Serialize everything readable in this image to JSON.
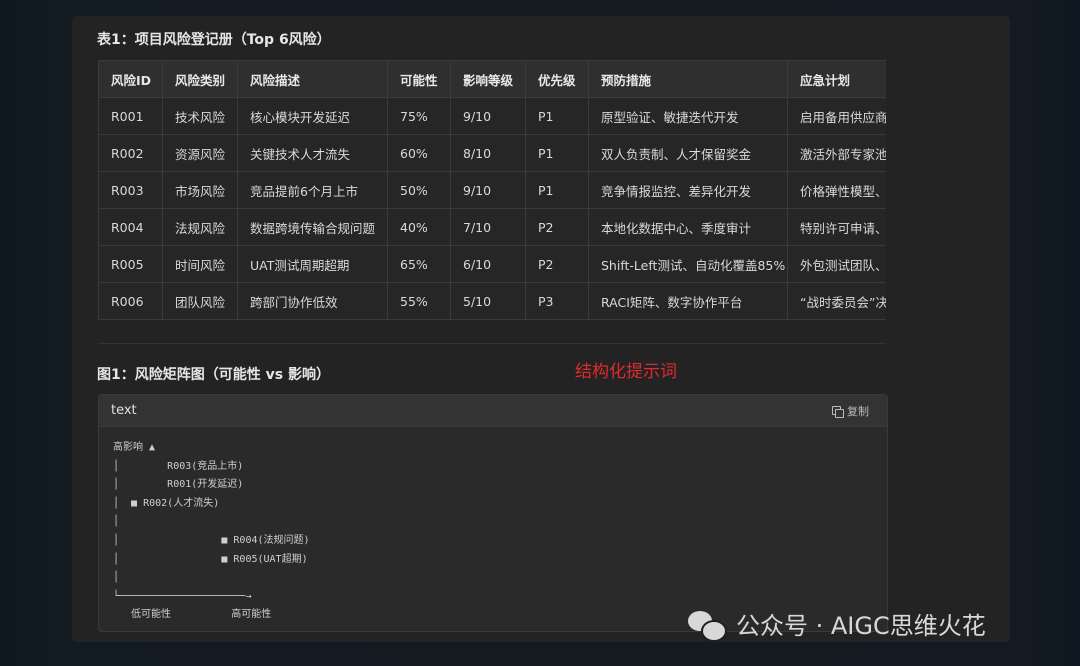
{
  "table_title": "表1：项目风险登记册（Top 6风险）",
  "table": {
    "headers": [
      "风险ID",
      "风险类别",
      "风险描述",
      "可能性",
      "影响等级",
      "优先级",
      "预防措施",
      "应急计划"
    ],
    "rows": [
      [
        "R001",
        "技术风险",
        "核心模块开发延迟",
        "75%",
        "9/10",
        "P1",
        "原型验证、敏捷迭代开发",
        "启用备用供应商"
      ],
      [
        "R002",
        "资源风险",
        "关键技术人才流失",
        "60%",
        "8/10",
        "P1",
        "双人负责制、人才保留奖金",
        "激活外部专家池"
      ],
      [
        "R003",
        "市场风险",
        "竞品提前6个月上市",
        "50%",
        "9/10",
        "P1",
        "竞争情报监控、差异化开发",
        "价格弹性模型、"
      ],
      [
        "R004",
        "法规风险",
        "数据跨境传输合规问题",
        "40%",
        "7/10",
        "P2",
        "本地化数据中心、季度审计",
        "特别许可申请、"
      ],
      [
        "R005",
        "时间风险",
        "UAT测试周期超期",
        "65%",
        "6/10",
        "P2",
        "Shift-Left测试、自动化覆盖85%",
        "外包测试团队、"
      ],
      [
        "R006",
        "团队风险",
        "跨部门协作低效",
        "55%",
        "5/10",
        "P3",
        "RACI矩阵、数字协作平台",
        "“战时委员会”决"
      ]
    ]
  },
  "figure_title": "图1：风险矩阵图（可能性 vs 影响）",
  "annotation": "结构化提示词",
  "code": {
    "language": "text",
    "copy_label": "复制",
    "content": "高影响 ▲\n│        R003(竞品上市)\n│        R001(开发延迟)\n│  ■ R002(人才流失)\n│\n│                 ■ R004(法规问题)\n│                 ■ R005(UAT超期)\n│\n└─────────────────────→\n   低可能性          高可能性"
  },
  "watermark": "公众号 · AIGC思维火花"
}
